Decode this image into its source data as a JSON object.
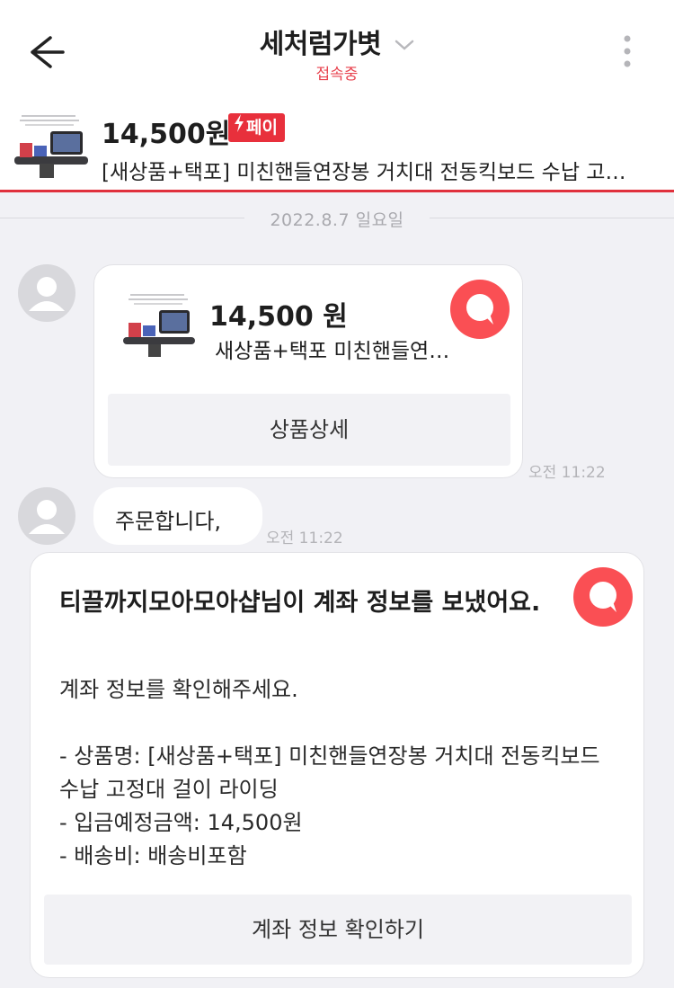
{
  "header": {
    "title": "세처럼가볏",
    "status": "접속중"
  },
  "product_bar": {
    "price": "14,500원",
    "pay_badge": "페이",
    "title": "[새상품+택포] 미친핸들연장봉 거치대 전동킥보드 수납 고정대 걸이 라이딩"
  },
  "date_separator": "2022.8.7 일요일",
  "messages": {
    "product_card": {
      "price": "14,500 원",
      "title": "새상품+택포  미친핸들연장봉 거치대",
      "detail_button": "상품상세",
      "time": "오전 11:22"
    },
    "text_message": {
      "text": "주문합니다,",
      "time": "오전 11:22"
    },
    "account_card": {
      "title": "티끌까지모아모아샵님이 계좌 정보를 보냈어요.",
      "body": "계좌 정보를 확인해주세요.\n\n- 상품명: [새상품+택포] 미친핸들연장봉 거치대 전동킥보드 수납 고정대 걸이 라이딩\n- 입금예정금액: 14,500원\n- 배송비: 배송비포함",
      "button": "계좌 정보 확인하기"
    }
  },
  "colors": {
    "accent_red": "#e8303c",
    "logo_coral": "#fa4f54",
    "background": "#f1f1f5"
  }
}
